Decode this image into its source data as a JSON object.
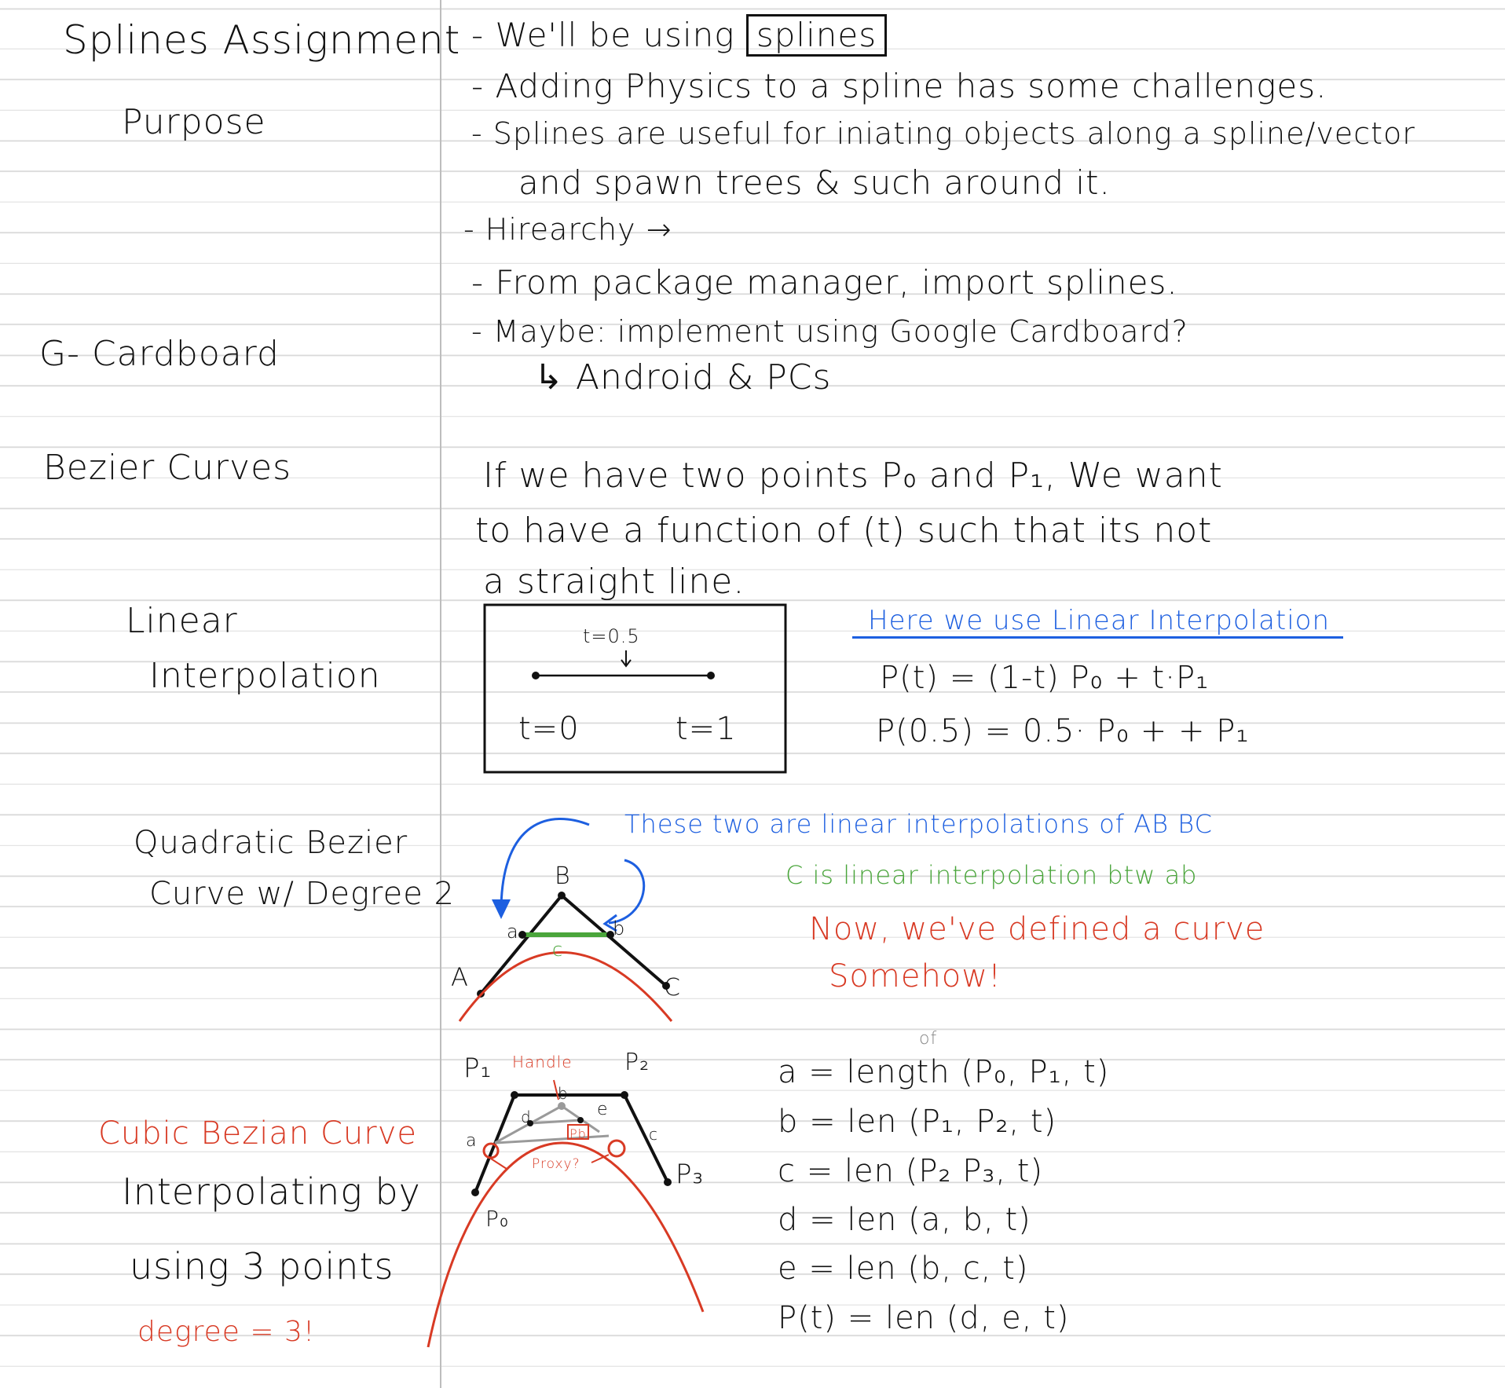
{
  "cues": {
    "title": "Splines Assignment",
    "purpose": "Purpose",
    "g_cardboard": "G- Cardboard",
    "bezier_curves": "Bezier Curves",
    "linear_1": "Linear",
    "linear_2": "Interpolation",
    "quadratic_1": "Quadratic Bezier",
    "quadratic_2": "Curve w/ Degree 2",
    "cubic_1": "Cubic Bezian Curve",
    "cubic_2": "Interpolating by",
    "cubic_3": "using 3 points",
    "cubic_4": "degree = 3!"
  },
  "notes": {
    "b1_prefix": "- We'll be using",
    "b1_boxed": "splines",
    "b2": "- Adding Physics to a spline has some challenges.",
    "b3_line1": "- Splines are useful for iniating objects along a spline/vector",
    "b3_line2": "and spawn trees & such around it.",
    "b4": "- Hirearchy →",
    "b5": "- From package manager, import splines.",
    "b6": "- Maybe: implement using Google Cardboard?",
    "b6_sub": "↳ Android & PCs",
    "intro_1": "If we have two points P₀ and P₁, We want",
    "intro_2": "to have a function of (t) such that its not",
    "intro_3": "a straight line."
  },
  "linear": {
    "box_t_mid": "t=0.5",
    "box_t0": "t=0",
    "box_t1": "t=1",
    "heading": "Here we use Linear Interpolation",
    "eq1": "P(t) = (1-t) P₀ + t·P₁",
    "eq2": "P(0.5) = 0.5· P₀ + + P₁"
  },
  "quadratic": {
    "note_blue": "These two are linear interpolations of AB BC",
    "note_green": "C is linear interpolation btw ab",
    "note_red_1": "Now, we've defined a curve",
    "note_red_2": "Somehow!",
    "label_A": "A",
    "label_B": "B",
    "label_C": "C",
    "label_a": "a",
    "label_b": "b",
    "label_c": "c"
  },
  "cubic": {
    "label_P0": "P₀",
    "label_P1": "P₁",
    "label_P2": "P₂",
    "label_P3": "P₃",
    "label_handle": "Handle",
    "label_proxy": "Proxy?",
    "label_of": "of",
    "label_a": "a",
    "label_b": "b",
    "label_c": "c",
    "label_d": "d",
    "label_e": "e",
    "label_Pb": "Pb",
    "eq_a": "a = length (P₀, P₁, t)",
    "eq_b": "b = len (P₁, P₂, t)",
    "eq_c": "c = len (P₂ P₃, t)",
    "eq_d": "d = len (a, b, t)",
    "eq_e": "e = len (b, c, t)",
    "eq_p": "P(t) = len (d, e, t)"
  },
  "colors": {
    "ink": "#111111",
    "blue": "#1d5fe0",
    "green": "#4aa53b",
    "red": "#d83a24",
    "rule": "#d9d9d9",
    "margin": "#bdbdbd"
  }
}
